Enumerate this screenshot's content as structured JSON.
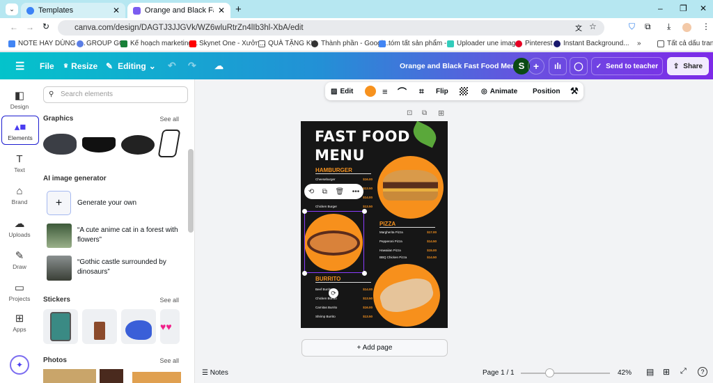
{
  "browser": {
    "tabs": [
      {
        "label": "Templates"
      },
      {
        "label": "Orange and Black Fast Food Me"
      }
    ],
    "url": "canva.com/design/DAGTJ3JJGVk/WZ6wluRtrZn4lIb3hl-XbA/edit",
    "bookmarks": [
      "NOTE HAY DÙNG -...",
      "GROUP GG",
      "Kế hoạch marketing...",
      "Skynet One - Xưởn...",
      "QUÀ TẶNG KH",
      "Thành phần - Googl...",
      "tóm tất sản phẩm -...",
      "Uploader une imag...",
      "Pinterest",
      "Instant Background..."
    ],
    "all_bookmarks": "Tất cả dấu trang"
  },
  "header": {
    "file": "File",
    "resize": "Resize",
    "editing": "Editing",
    "title": "Orange and Black Fast Food Menu",
    "avatar": "S",
    "send": "Send to teacher",
    "share": "Share"
  },
  "rail": [
    {
      "label": "Design"
    },
    {
      "label": "Elements"
    },
    {
      "label": "Text"
    },
    {
      "label": "Brand"
    },
    {
      "label": "Uploads"
    },
    {
      "label": "Draw"
    },
    {
      "label": "Projects"
    },
    {
      "label": "Apps"
    }
  ],
  "panel": {
    "search_placeholder": "Search elements",
    "graphics": "Graphics",
    "see_all": "See all",
    "ai": "AI image generator",
    "generate": "Generate your own",
    "prompt1": "“A cute anime cat in a forest with flowers”",
    "prompt2": "“Gothic castle surrounded by dinosaurs”",
    "stickers": "Stickers",
    "photos": "Photos"
  },
  "toolbar": {
    "edit": "Edit",
    "color": "#f7921e",
    "flip": "Flip",
    "animate": "Animate",
    "position": "Position"
  },
  "menu": {
    "title1": "FAST FOOD",
    "title2": "MENU",
    "hamburger": {
      "title": "HAMBURGER",
      "items": [
        {
          "name": "Cheeseburger",
          "price": "$16.00"
        },
        {
          "name": "",
          "price": "$13.50"
        },
        {
          "name": "",
          "price": "$14.00"
        },
        {
          "name": "Chicken Burger",
          "price": "$13.50"
        }
      ]
    },
    "pizza": {
      "title": "PIZZA",
      "items": [
        {
          "name": "Margherita Pizza",
          "price": "$17.00"
        },
        {
          "name": "Pepperoni Pizza",
          "price": "$14.50"
        },
        {
          "name": "Hawaiian Pizza",
          "price": "$15.00"
        },
        {
          "name": "BBQ Chicken Pizza",
          "price": "$14.50"
        }
      ]
    },
    "burrito": {
      "title": "BURRITO",
      "items": [
        {
          "name": "Beef Burrito",
          "price": "$14.00"
        },
        {
          "name": "Chicken Burrito",
          "price": "$13.50"
        },
        {
          "name": "Carnitas Burrito",
          "price": "$16.00"
        },
        {
          "name": "Shrimp Burrito",
          "price": "$13.50"
        }
      ]
    }
  },
  "add_page": "+ Add page",
  "footer": {
    "notes": "Notes",
    "page": "Page 1 / 1",
    "zoom": "42%",
    "zoom_value": 42
  }
}
